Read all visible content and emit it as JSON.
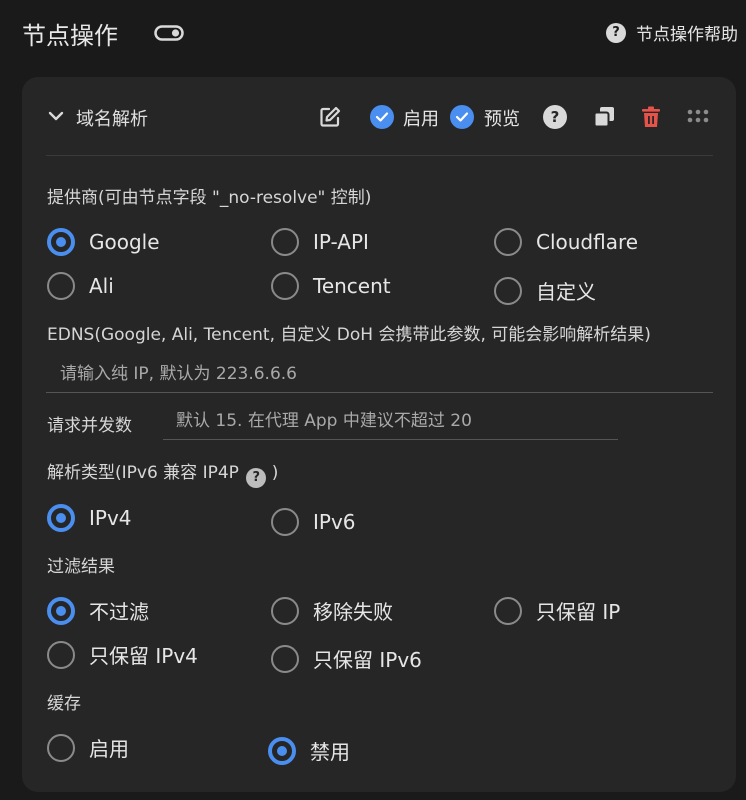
{
  "header": {
    "title": "节点操作",
    "help_label": "节点操作帮助"
  },
  "card": {
    "title": "域名解析",
    "enable_label": "启用",
    "preview_label": "预览",
    "provider": {
      "label": "提供商(可由节点字段 \"_no-resolve\" 控制)",
      "options": [
        "Google",
        "IP-API",
        "Cloudflare",
        "Ali",
        "Tencent",
        "自定义"
      ],
      "selected": "Google"
    },
    "edns": {
      "label": "EDNS(Google, Ali, Tencent, 自定义 DoH 会携带此参数, 可能会影响解析结果)",
      "placeholder": "请输入纯 IP, 默认为 223.6.6.6"
    },
    "concurrency": {
      "label": "请求并发数",
      "placeholder": "默认 15. 在代理 App 中建议不超过 20"
    },
    "resolve_type": {
      "label": "解析类型(IPv6 兼容 IP4P",
      "label_suffix": ")",
      "options": [
        "IPv4",
        "IPv6"
      ],
      "selected": "IPv4"
    },
    "filter": {
      "label": "过滤结果",
      "options": [
        "不过滤",
        "移除失败",
        "只保留 IP",
        "只保留 IPv4",
        "只保留 IPv6"
      ],
      "selected": "不过滤"
    },
    "cache": {
      "label": "缓存",
      "options": [
        "启用",
        "禁用"
      ],
      "selected": "禁用"
    }
  },
  "colors": {
    "accent": "#4a8ef0",
    "danger": "#e5534b",
    "background": "#1a1a1a",
    "card": "#262626"
  }
}
